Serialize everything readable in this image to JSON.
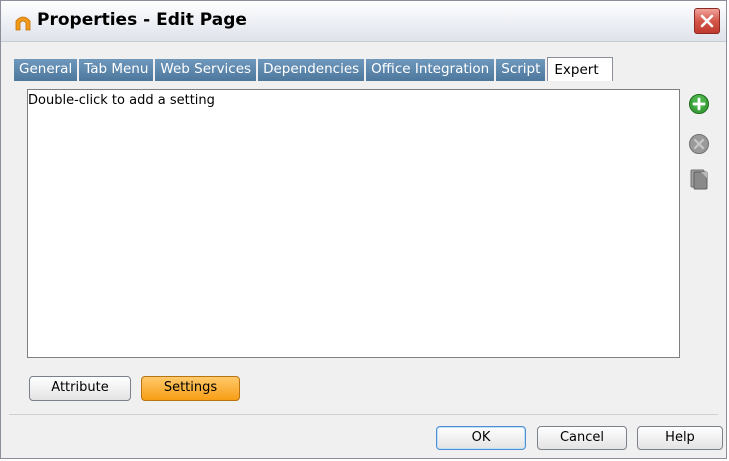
{
  "window": {
    "title": "Properties - Edit Page",
    "icon": "app-logo-icon"
  },
  "tabs": [
    {
      "label": "General"
    },
    {
      "label": "Tab Menu"
    },
    {
      "label": "Web Services"
    },
    {
      "label": "Dependencies"
    },
    {
      "label": "Office Integration"
    },
    {
      "label": "Script"
    },
    {
      "label": "Expert",
      "active": true
    }
  ],
  "content": {
    "hint": "Double-click to add a setting"
  },
  "side_icons": [
    "add-icon",
    "delete-icon",
    "copy-icon"
  ],
  "view_buttons": {
    "attribute": "Attribute",
    "settings": "Settings"
  },
  "dialog_buttons": {
    "ok": "OK",
    "cancel": "Cancel",
    "help": "Help"
  },
  "colors": {
    "tab_blue": "#5a83a8",
    "settings_orange": "#f7a020",
    "close_red": "#d4564a",
    "add_green": "#3aa03a"
  }
}
